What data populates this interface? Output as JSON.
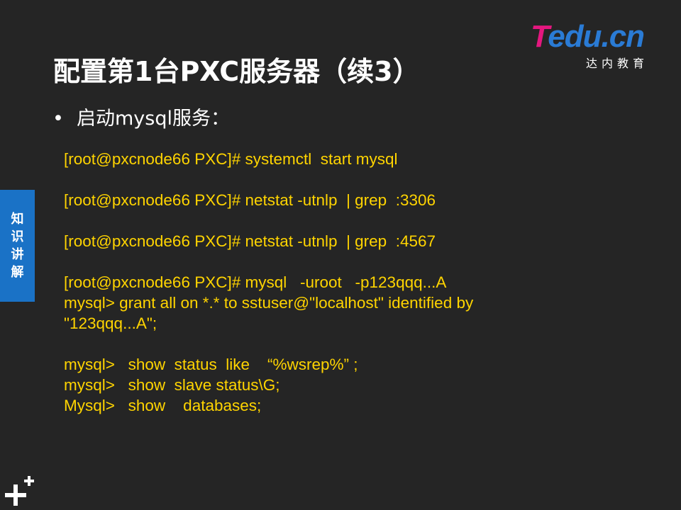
{
  "slide": {
    "title": "配置第1台PXC服务器（续3）",
    "bullet": "启动mysql服务：",
    "code_lines": [
      "[root@pxcnode66 PXC]# systemctl  start mysql",
      "",
      "[root@pxcnode66 PXC]# netstat -utnlp  | grep  :3306",
      "",
      "[root@pxcnode66 PXC]# netstat -utnlp  | grep  :4567",
      "",
      "[root@pxcnode66 PXC]# mysql   -uroot   -p123qqq...A",
      "mysql> grant all on *.* to sstuser@\"localhost\" identified by",
      "\"123qqq...A\";",
      "",
      "mysql>   show  status  like    “%wsrep%” ;",
      "mysql>   show  slave status\\G;",
      "Mysql>   show    databases;"
    ],
    "side_tab": [
      "知",
      "识",
      "讲",
      "解"
    ]
  },
  "logo": {
    "brand_t": "T",
    "brand_rest": "edu.cn",
    "sub": "达内教育"
  },
  "colors": {
    "background": "#252525",
    "code_text": "#ffd400",
    "side_tab": "#1a72c6",
    "logo_pink": "#e4177f",
    "logo_blue": "#2a7bd5"
  },
  "icons": {
    "bottom_left": "plus-plus-icon",
    "bullet": "bullet-dot-icon"
  }
}
